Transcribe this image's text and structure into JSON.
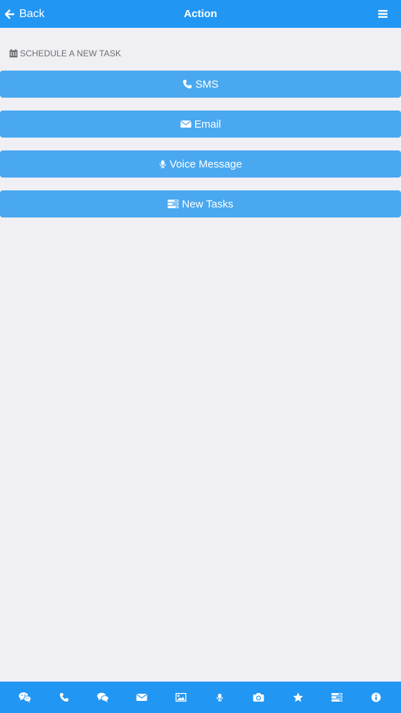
{
  "header": {
    "back_label": "Back",
    "title": "Action",
    "menu_icon": "hamburger-icon"
  },
  "section": {
    "label": "SCHEDULE A NEW TASK",
    "icon": "calendar-icon"
  },
  "actions": [
    {
      "label": "SMS",
      "icon": "phone-icon"
    },
    {
      "label": "Email",
      "icon": "envelope-icon"
    },
    {
      "label": "Voice Message",
      "icon": "microphone-icon"
    },
    {
      "label": "New Tasks",
      "icon": "tasks-icon"
    }
  ],
  "bottom_nav": [
    {
      "icon": "wechat-icon"
    },
    {
      "icon": "phone-icon"
    },
    {
      "icon": "chat-icon"
    },
    {
      "icon": "envelope-icon"
    },
    {
      "icon": "image-icon"
    },
    {
      "icon": "microphone-icon"
    },
    {
      "icon": "camera-icon"
    },
    {
      "icon": "star-icon"
    },
    {
      "icon": "tasks-icon"
    },
    {
      "icon": "info-icon"
    }
  ],
  "colors": {
    "header_bg": "#2196f3",
    "button_bg": "#4aa8f0",
    "page_bg": "#efeff4",
    "label_text": "#6d6d72"
  }
}
